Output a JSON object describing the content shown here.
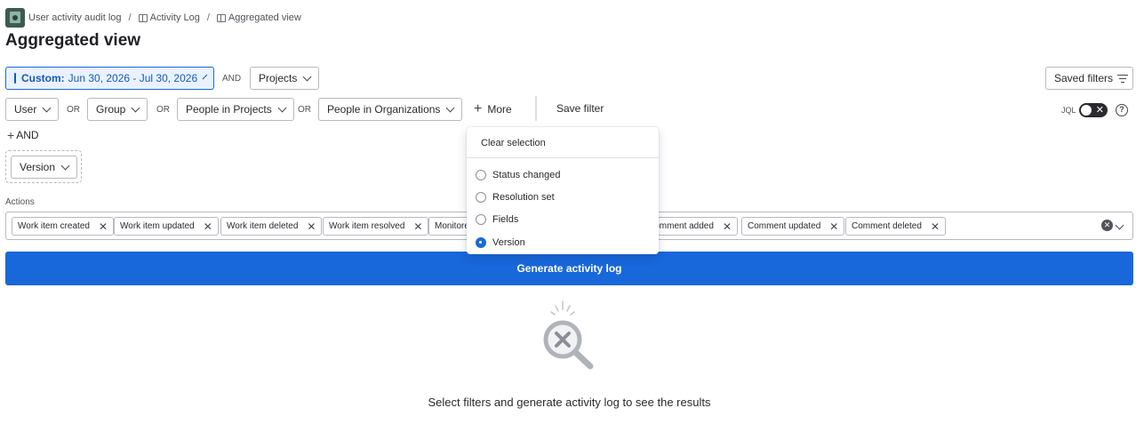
{
  "breadcrumb": {
    "app": "User activity audit log",
    "activity_log": "Activity Log",
    "current": "Aggregated view",
    "separator": "/"
  },
  "page_title": "Aggregated view",
  "filters": {
    "date": {
      "label": "Custom:",
      "range": "Jun 30, 2026 - Jul 30, 2026"
    },
    "and1": "AND",
    "projects": "Projects",
    "user": "User",
    "or1": "OR",
    "group": "Group",
    "or2": "OR",
    "people_in_projects": "People in Projects",
    "or3": "OR",
    "people_in_orgs": "People in Organizations",
    "more": "More",
    "save_filter": "Save filter",
    "add_and": "AND",
    "version": "Version"
  },
  "saved_filters": "Saved filters",
  "jql": {
    "label": "JQL",
    "enabled": false
  },
  "actions": {
    "label": "Actions",
    "chips": [
      "Work item created",
      "Work item updated",
      "Work item deleted",
      "Work item resolved",
      "Monitored",
      "Comment added",
      "Comment updated",
      "Comment deleted"
    ]
  },
  "generate_button": "Generate activity log",
  "dropdown": {
    "clear": "Clear selection",
    "options": [
      {
        "label": "Status changed",
        "selected": false
      },
      {
        "label": "Resolution set",
        "selected": false
      },
      {
        "label": "Fields",
        "selected": false
      },
      {
        "label": "Version",
        "selected": true
      }
    ]
  },
  "empty_state": {
    "message": "Select filters and generate activity log to see the results",
    "icon": "search-no-results-icon"
  },
  "colors": {
    "primary": "#1868db",
    "selected_bg": "#e9f2fe",
    "text": "#292a2e"
  }
}
